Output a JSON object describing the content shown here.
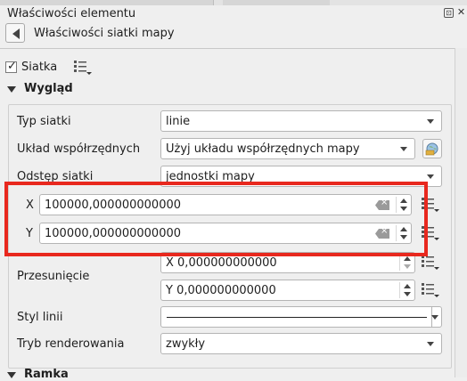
{
  "panel": {
    "title": "Właściwości elementu",
    "float_icon": "⊡",
    "close_icon": "✕"
  },
  "header": {
    "breadcrumb": "Właściwości siatki mapy"
  },
  "grid": {
    "checkbox_label": "Siatka",
    "checked": true
  },
  "appearance": {
    "section_title": "Wygląd",
    "grid_type_label": "Typ siatki",
    "grid_type_value": "linie",
    "crs_label": "Układ współrzędnych",
    "crs_value": "Użyj układu współrzędnych mapy",
    "interval_label": "Odstęp siatki",
    "interval_value": "jednostki mapy",
    "x_label": "X",
    "x_value": "100000,000000000000",
    "y_label": "Y",
    "y_value": "100000,000000000000",
    "offset_label": "Przesunięcie",
    "offset_x_value": "X 0,000000000000",
    "offset_y_value": "Y 0,000000000000",
    "line_style_label": "Styl linii",
    "render_mode_label": "Tryb renderowania",
    "render_mode_value": "zwykły"
  },
  "frame": {
    "section_title": "Ramka"
  },
  "colors": {
    "highlight": "#e8281e"
  }
}
